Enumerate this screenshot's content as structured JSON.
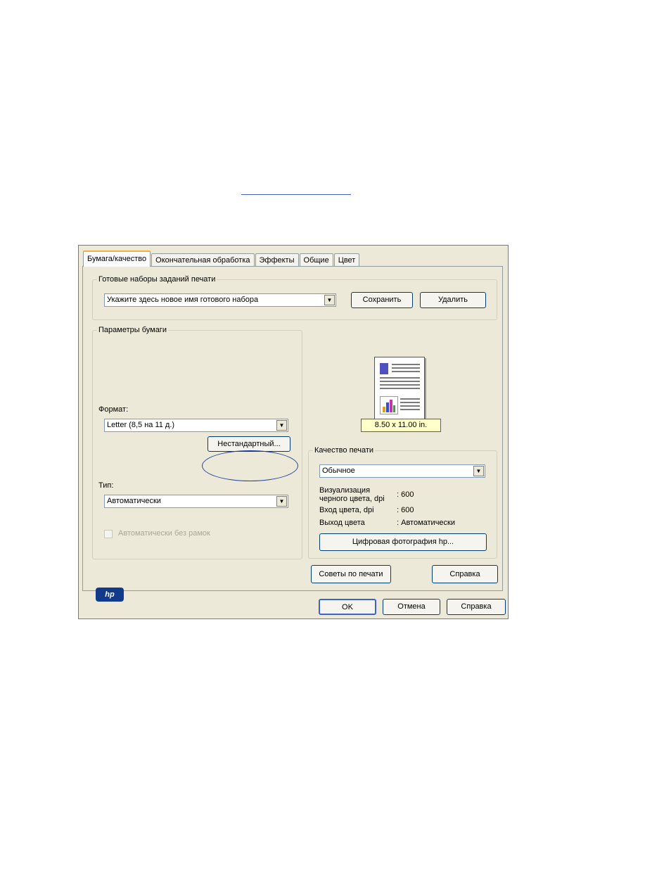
{
  "tabs": [
    "Бумага/качество",
    "Окончательная обработка",
    "Эффекты",
    "Общие",
    "Цвет"
  ],
  "presets": {
    "legend": "Готовые наборы заданий печати",
    "input": "Укажите здесь новое имя готового набора",
    "save": "Сохранить",
    "delete": "Удалить"
  },
  "paper": {
    "legend": "Параметры бумаги",
    "format_label": "Формат:",
    "format_value": "Letter (8,5 на 11 д.)",
    "custom_button": "Нестандартный...",
    "type_label": "Тип:",
    "type_value": "Автоматически",
    "borderless": "Автоматически без рамок"
  },
  "preview": {
    "size": "8.50 x 11.00 in."
  },
  "quality": {
    "legend": "Качество печати",
    "value": "Обычное",
    "black_label": "Визуализация\nчерного цвета, dpi",
    "black_value": ": 600",
    "color_in_label": "Вход цвета, dpi",
    "color_in_value": ": 600",
    "color_out_label": "Выход цвета",
    "color_out_value": ": Автоматически",
    "photo_button": "Цифровая фотография hp..."
  },
  "bottom": {
    "logo": "hp",
    "tips": "Советы по печати",
    "help": "Справка"
  },
  "footer": {
    "ok": "OK",
    "cancel": "Отмена",
    "help": "Справка"
  }
}
